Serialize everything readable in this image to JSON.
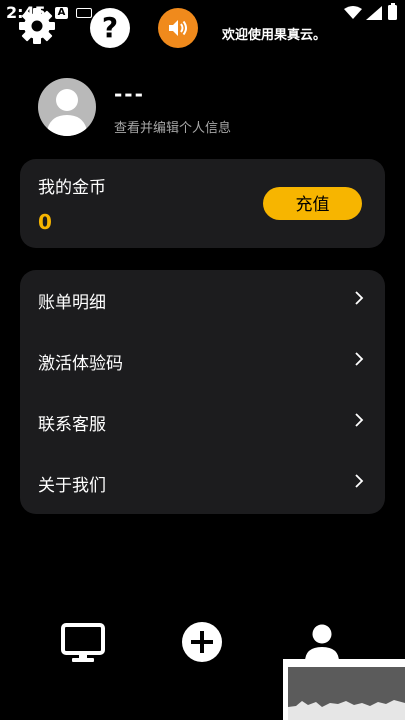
{
  "status_bar": {
    "time": "2:45",
    "notification_icons": [
      "accessibility-a-icon",
      "keyboard-icon"
    ],
    "system_icons": [
      "wifi-icon",
      "signal-icon",
      "battery-icon"
    ]
  },
  "top_bar": {
    "icons": [
      "gear-icon",
      "help-icon",
      "speaker-icon"
    ],
    "accent_color": "#f08a1c",
    "marquee_text": "欢迎使用果真云。"
  },
  "profile": {
    "name": "---",
    "subtitle": "查看并编辑个人信息"
  },
  "coins": {
    "title": "我的金币",
    "value": "0",
    "recharge_label": "充值",
    "accent_color": "#f7b500"
  },
  "menu": {
    "items": [
      {
        "label": "账单明细"
      },
      {
        "label": "激活体验码"
      },
      {
        "label": "联系客服"
      },
      {
        "label": "关于我们"
      }
    ]
  },
  "bottom_nav": {
    "items": [
      "monitor-icon",
      "add-icon",
      "user-icon"
    ]
  }
}
